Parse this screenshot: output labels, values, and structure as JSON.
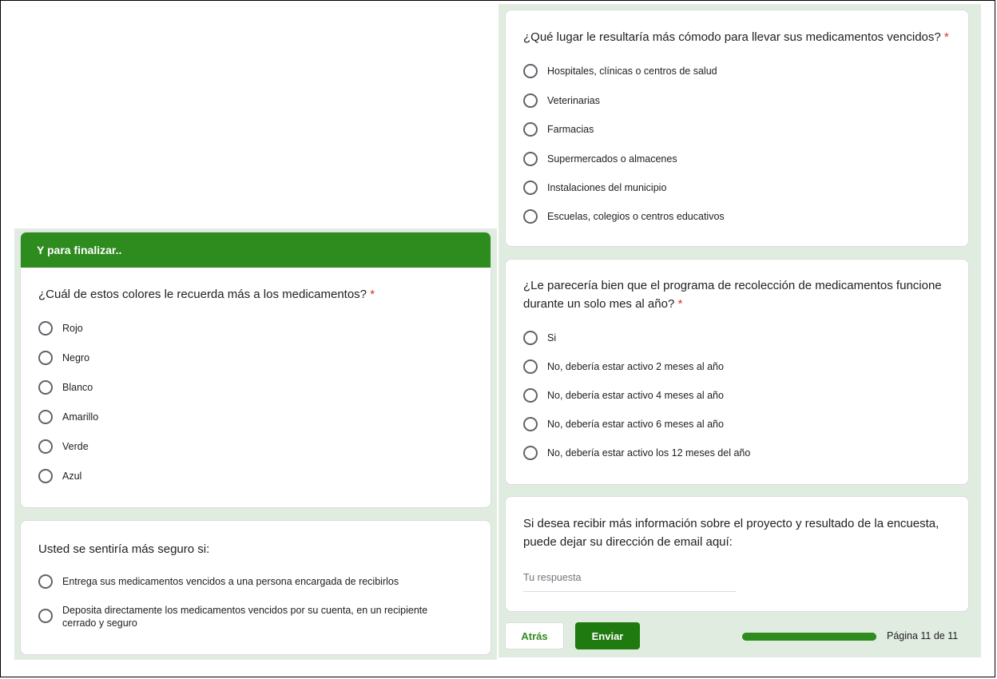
{
  "section": {
    "title": "Y para finalizar.."
  },
  "q_color": {
    "text": "¿Cuál de estos colores le recuerda más a los medicamentos?",
    "required_mark": "*",
    "options": [
      "Rojo",
      "Negro",
      "Blanco",
      "Amarillo",
      "Verde",
      "Azul"
    ]
  },
  "q_safe": {
    "text": "Usted se sentiría más seguro si:",
    "options": [
      "Entrega sus medicamentos vencidos a una persona encargada de recibirlos",
      "Deposita directamente los medicamentos vencidos por su cuenta, en un recipiente cerrado y seguro"
    ]
  },
  "q_place": {
    "text": "¿Qué lugar le resultaría más cómodo para llevar sus medicamentos vencidos?",
    "required_mark": "*",
    "options": [
      "Hospitales, clínicas o centros de salud",
      "Veterinarias",
      "Farmacias",
      "Supermercados o almacenes",
      "Instalaciones del municipio",
      "Escuelas, colegios o centros educativos"
    ]
  },
  "q_month": {
    "text": "¿Le parecería bien que el programa de recolección de medicamentos funcione durante un solo mes al año?",
    "required_mark": "*",
    "options": [
      "Si",
      "No, debería estar activo 2 meses al año",
      "No, debería estar activo 4 meses al año",
      "No, debería estar activo 6 meses al año",
      "No, debería estar activo los 12 meses del año"
    ]
  },
  "q_email": {
    "text": "Si desea recibir más información sobre el proyecto y resultado de la encuesta, puede dejar su dirección de email aquí:",
    "placeholder": "Tu respuesta"
  },
  "nav": {
    "back_label": "Atrás",
    "send_label": "Enviar",
    "progress_fraction": 1.0,
    "page_label": "Página 11 de 11"
  },
  "colors": {
    "accent": "#2e8b1e",
    "background": "#e1ece1",
    "required": "#d93025"
  }
}
